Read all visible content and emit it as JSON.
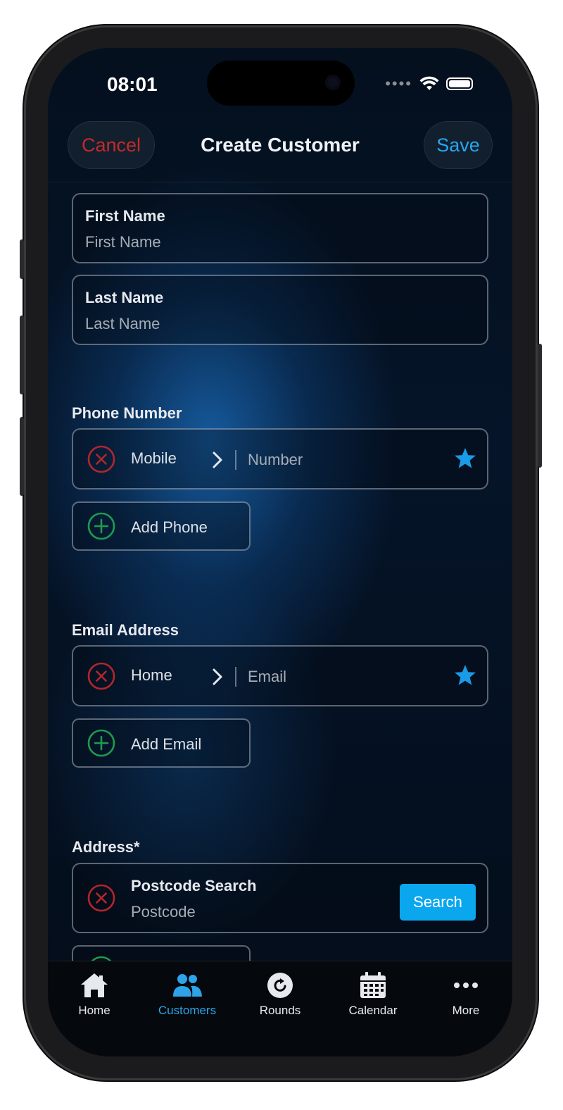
{
  "status_bar": {
    "time": "08:01"
  },
  "nav": {
    "cancel_label": "Cancel",
    "title": "Create Customer",
    "save_label": "Save"
  },
  "fields": {
    "first_name": {
      "label": "First Name",
      "placeholder": "First Name"
    },
    "last_name": {
      "label": "Last Name",
      "placeholder": "Last Name"
    }
  },
  "phone": {
    "section_title": "Phone Number",
    "type": "Mobile",
    "placeholder": "Number",
    "add_label": "Add Phone"
  },
  "email": {
    "section_title": "Email Address",
    "type": "Home",
    "placeholder": "Email",
    "add_label": "Add Email"
  },
  "address": {
    "section_title": "Address*",
    "postcode_label": "Postcode Search",
    "postcode_placeholder": "Postcode",
    "search_label": "Search"
  },
  "tabbar": {
    "items": [
      {
        "label": "Home",
        "icon": "house-icon"
      },
      {
        "label": "Customers",
        "icon": "people-icon",
        "active": true
      },
      {
        "label": "Rounds",
        "icon": "refresh-icon"
      },
      {
        "label": "Calendar",
        "icon": "calendar-icon"
      },
      {
        "label": "More",
        "icon": "ellipsis-icon"
      }
    ]
  },
  "colors": {
    "accent": "#26a6f0",
    "danger": "#c42a2a",
    "add_green": "#1f9a4f",
    "search_button": "#0aa7ef"
  }
}
